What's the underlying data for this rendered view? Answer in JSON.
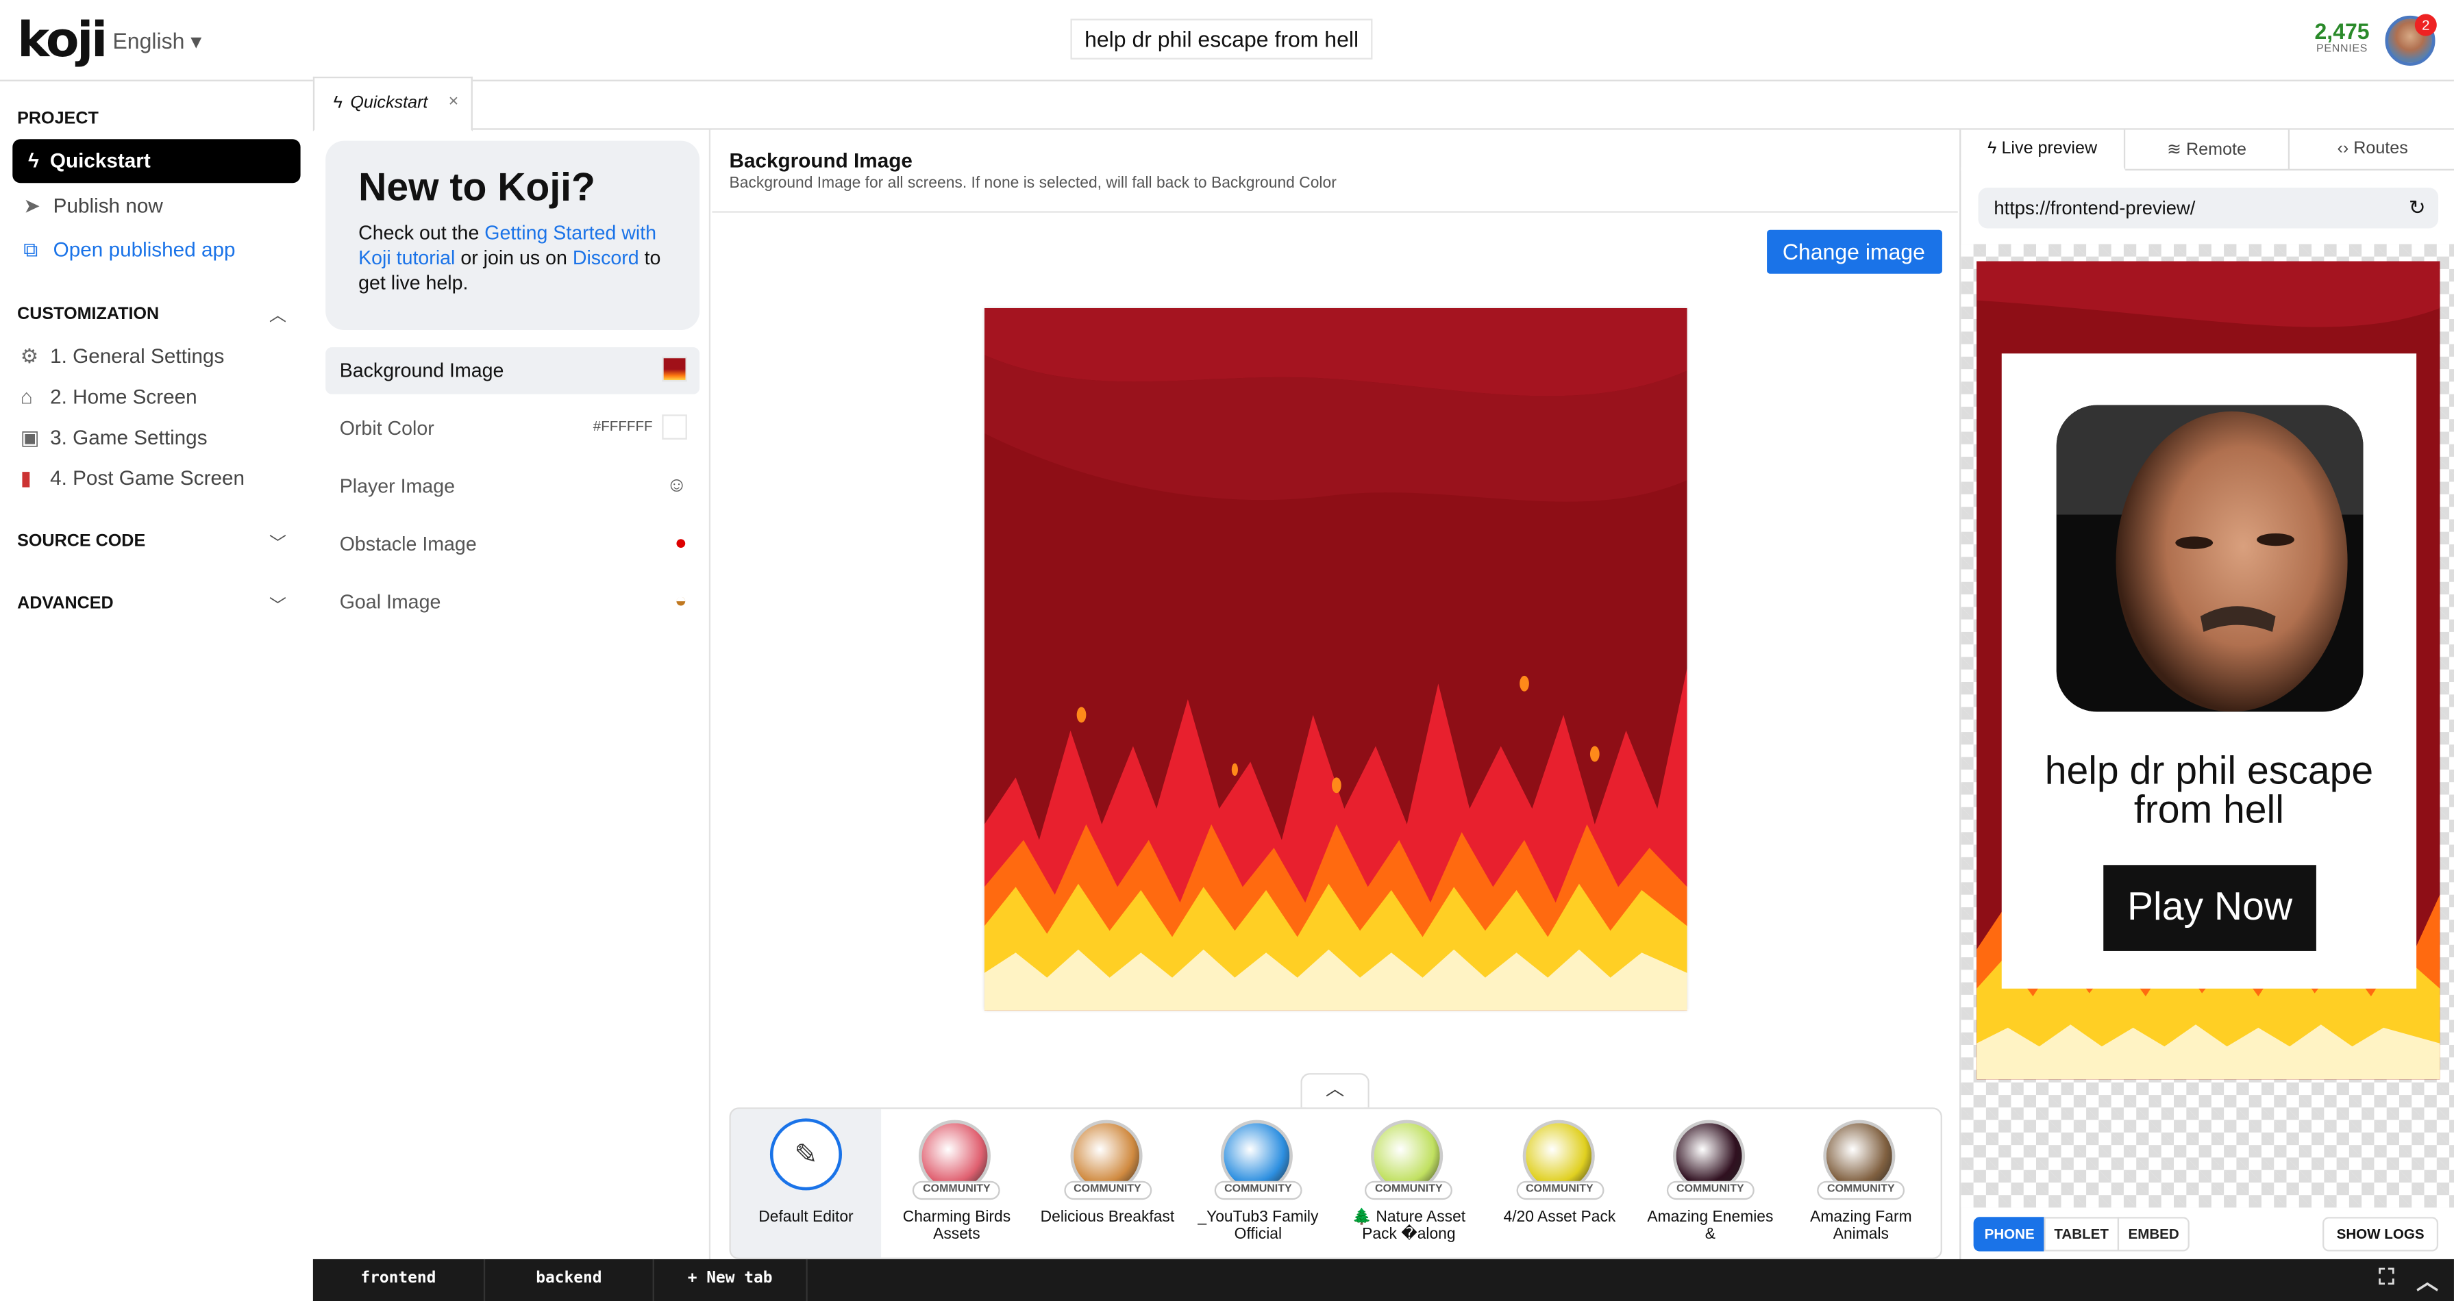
{
  "header": {
    "logo": "koji",
    "language": "English",
    "title": "help dr phil escape from hell",
    "pennies_count": "2,475",
    "pennies_label": "PENNIES",
    "notifications": "2"
  },
  "sidebar": {
    "project_label": "PROJECT",
    "quickstart": "Quickstart",
    "publish": "Publish now",
    "open_app": "Open published app",
    "customization_label": "CUSTOMIZATION",
    "custom_items": [
      "1. General Settings",
      "2. Home Screen",
      "3. Game Settings",
      "4. Post Game Screen"
    ],
    "source_label": "SOURCE CODE",
    "advanced_label": "ADVANCED"
  },
  "editor_tab": {
    "label": "Quickstart"
  },
  "onboard": {
    "heading": "New to Koji?",
    "t1": "Check out the ",
    "link1": "Getting Started with Koji tutorial",
    "t2": " or join us on ",
    "link2": "Discord",
    "t3": " to get live help."
  },
  "props": [
    {
      "label": "Background Image",
      "icon": "flame-thumb"
    },
    {
      "label": "Orbit Color",
      "value": "#FFFFFF"
    },
    {
      "label": "Player Image",
      "icon": "face-thumb"
    },
    {
      "label": "Obstacle Image",
      "icon": "apple-icon"
    },
    {
      "label": "Goal Image",
      "icon": "burger-icon"
    }
  ],
  "main": {
    "heading": "Background Image",
    "sub": "Background Image for all screens. If none is selected, will fall back to Background Color",
    "change_button": "Change image"
  },
  "assets": [
    {
      "name": "Default Editor"
    },
    {
      "name": "Charming Birds Assets",
      "tag": "COMMUNITY",
      "color": "#e06070"
    },
    {
      "name": "Delicious Breakfast",
      "tag": "COMMUNITY",
      "color": "#d08a40"
    },
    {
      "name": "_YouTub3 Family Official",
      "tag": "COMMUNITY",
      "color": "#2d8fe0"
    },
    {
      "name": "🌲 Nature Asset Pack �along",
      "tag": "COMMUNITY",
      "color": "#c0e060"
    },
    {
      "name": "4/20 Asset Pack",
      "tag": "COMMUNITY",
      "color": "#e0d020"
    },
    {
      "name": "Amazing Enemies &",
      "tag": "COMMUNITY",
      "color": "#301020"
    },
    {
      "name": "Amazing Farm Animals",
      "tag": "COMMUNITY",
      "color": "#806040"
    }
  ],
  "preview": {
    "tabs": [
      "Live preview",
      "Remote",
      "Routes"
    ],
    "url": "https://frontend-preview/",
    "game_title": "help dr phil escape from hell",
    "play_button": "Play Now",
    "devices": [
      "PHONE",
      "TABLET",
      "EMBED"
    ],
    "show_logs": "SHOW LOGS"
  },
  "bottom": {
    "tabs": [
      "frontend",
      "backend",
      "+ New tab"
    ]
  }
}
